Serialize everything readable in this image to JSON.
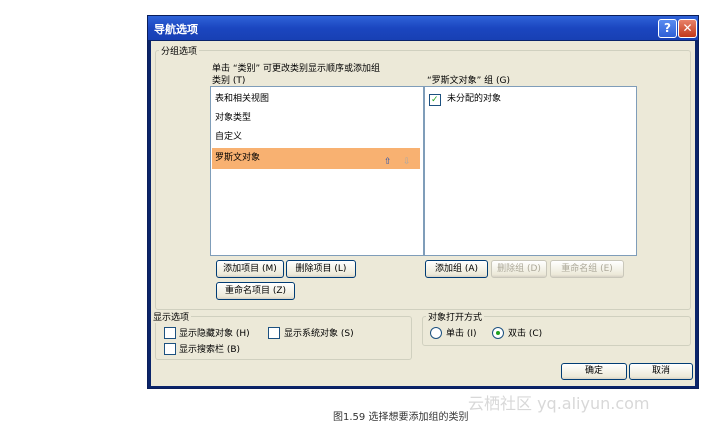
{
  "dialog": {
    "title": "导航选项",
    "help_label": "?",
    "close_label": "✕"
  },
  "grouping": {
    "legend": "分组选项",
    "instruction": "单击 “类别” 可更改类别显示顺序或添加组",
    "categories_label": "类别 (T)",
    "categories": [
      {
        "label": "表和相关视图"
      },
      {
        "label": "对象类型"
      },
      {
        "label": "自定义"
      },
      {
        "label": "罗斯文对象"
      }
    ],
    "selected_index": 3,
    "up_icon_glyph": "⇧",
    "down_icon_glyph": "⇩",
    "groups_label": "“罗斯文对象” 组 (G)",
    "groups": [
      {
        "label": "未分配的对象",
        "checked": true
      }
    ],
    "check_glyph": "✓",
    "add_item_button": "添加项目 (M)",
    "delete_item_button": "删除项目 (L)",
    "rename_item_button": "重命名项目 (Z)",
    "add_group_button": "添加组 (A)",
    "delete_group_button": "删除组 (D)",
    "rename_group_button": "重命名组 (E)"
  },
  "display": {
    "legend": "显示选项",
    "show_hidden": {
      "label": "显示隐藏对象 (H)",
      "checked": false
    },
    "show_system": {
      "label": "显示系统对象 (S)",
      "checked": false
    },
    "show_search": {
      "label": "显示搜索栏 (B)",
      "checked": false
    }
  },
  "open_mode": {
    "legend": "对象打开方式",
    "single": {
      "label": "单击 (I)",
      "selected": false
    },
    "double": {
      "label": "双击 (C)",
      "selected": true
    }
  },
  "footer": {
    "ok": "确定",
    "cancel": "取消"
  },
  "caption": "图1.59   选择想要添加组的类别",
  "watermark": "云栖社区 yq.aliyun.com"
}
